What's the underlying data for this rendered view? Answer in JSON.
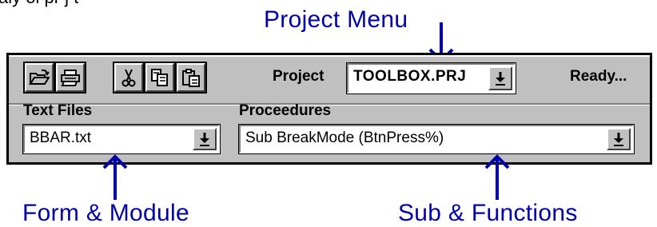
{
  "header_partial": "aly  ol  pr j  t",
  "callouts": {
    "project_menu": "Project Menu",
    "form_module": "Form & Module",
    "sub_functions": "Sub & Functions"
  },
  "toolbar": {
    "buttons": [
      "open-icon",
      "print-icon",
      "cut-icon",
      "copy-icon",
      "paste-icon"
    ],
    "project_label": "Project",
    "project_value": "TOOLBOX.PRJ",
    "status": "Ready...",
    "text_files_label": "Text Files",
    "text_files_value": "BBAR.txt",
    "procedures_label": "Proceedures",
    "procedures_value": "Sub BreakMode (BtnPress%)"
  },
  "colors": {
    "callout": "#0000a8",
    "face": "#c0c0c0"
  }
}
